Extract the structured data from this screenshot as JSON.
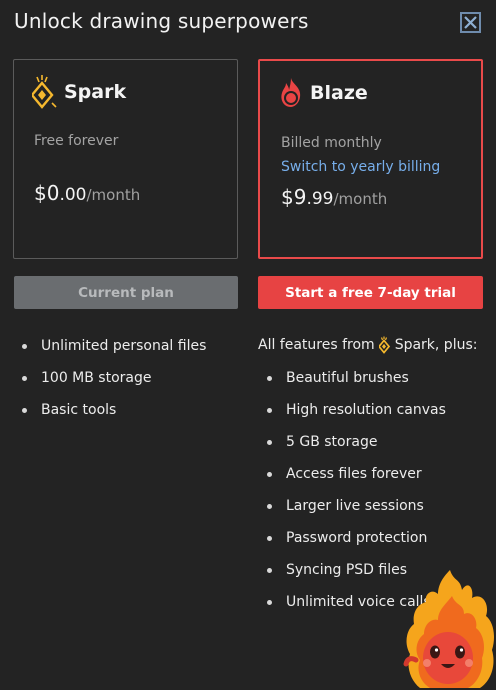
{
  "dialog": {
    "title": "Unlock drawing superpowers",
    "close_icon": "close-icon"
  },
  "plans": {
    "spark": {
      "name": "Spark",
      "icon": "spark-diamond-icon",
      "subtitle": "Free forever",
      "price_main": "$0",
      "price_cents": ".00",
      "price_period": "/month",
      "button_label": "Current plan",
      "features": [
        "Unlimited personal files",
        "100 MB storage",
        "Basic tools"
      ]
    },
    "blaze": {
      "name": "Blaze",
      "icon": "blaze-flame-icon",
      "subtitle": "Billed monthly",
      "switch_link": "Switch to yearly billing",
      "price_main": "$9",
      "price_cents": ".99",
      "price_period": "/month",
      "button_label": "Start a free 7-day trial",
      "features_intro_prefix": "All features from",
      "features_intro_plan": "Spark",
      "features_intro_suffix": ", plus:",
      "features": [
        "Beautiful brushes",
        "High resolution canvas",
        "5 GB storage",
        "Access files forever",
        "Larger live sessions",
        "Password protection",
        "Syncing PSD files",
        "Unlimited voice calls"
      ]
    }
  },
  "colors": {
    "background": "#232323",
    "accent_red": "#e74343",
    "link_blue": "#77aeea",
    "spark_gold": "#f5b82e"
  },
  "decoration": {
    "mascot": "flame-mascot-illustration"
  }
}
